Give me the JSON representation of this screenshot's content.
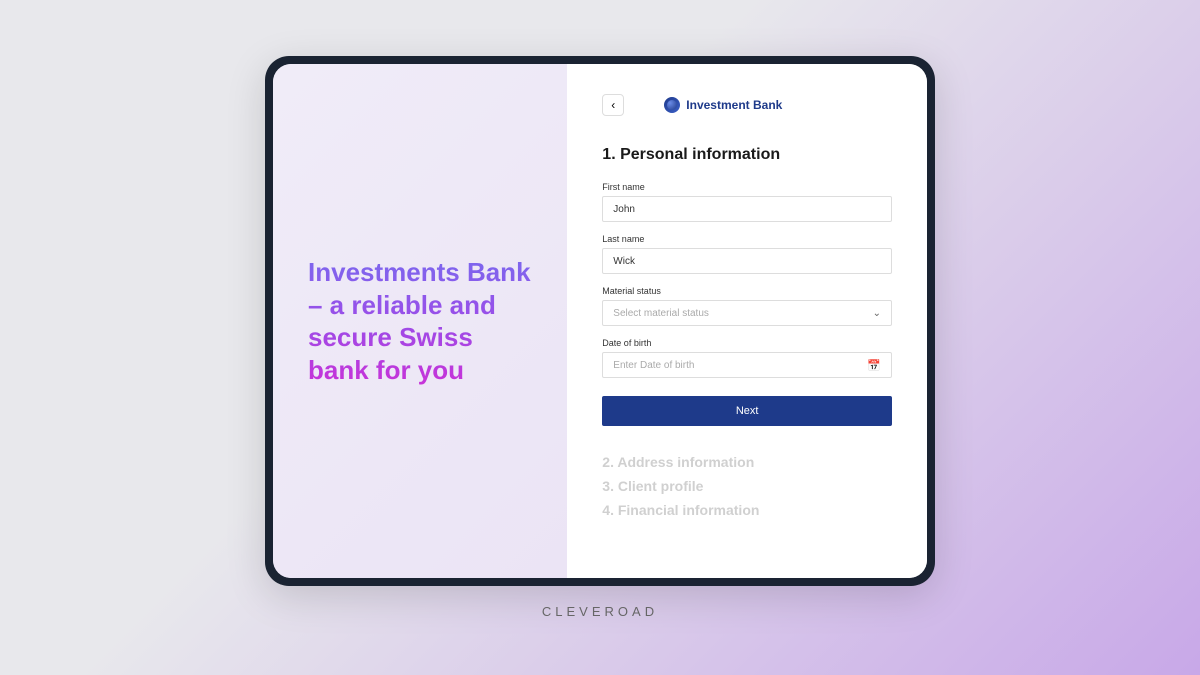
{
  "hero": {
    "text": "Investments Bank – a reliable and secure Swiss bank for you"
  },
  "brand": {
    "name": "Investment Bank"
  },
  "form": {
    "section_title": "1. Personal information",
    "fields": {
      "first_name": {
        "label": "First name",
        "value": "John"
      },
      "last_name": {
        "label": "Last name",
        "value": "Wick"
      },
      "material_status": {
        "label": "Material status",
        "placeholder": "Select material status"
      },
      "date_of_birth": {
        "label": "Date of birth",
        "placeholder": "Enter Date of birth"
      }
    },
    "next_label": "Next"
  },
  "steps": {
    "step2": "2. Address information",
    "step3": "3. Client profile",
    "step4": "4. Financial information"
  },
  "footer": {
    "brand": "CLEVEROAD"
  }
}
